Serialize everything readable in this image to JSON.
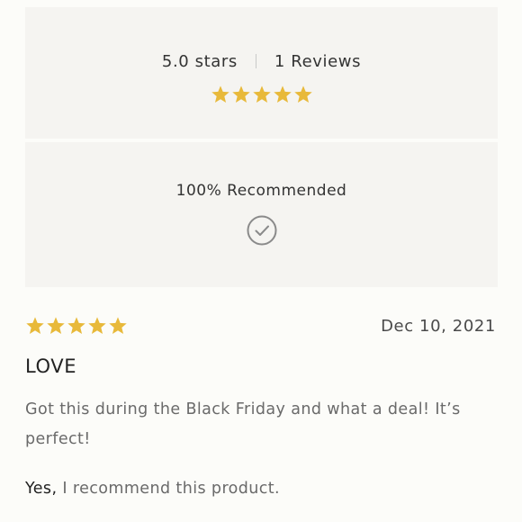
{
  "summary": {
    "average_label": "5.0 stars",
    "reviews_label": "1 Reviews",
    "star_rating": 5,
    "recommend_label": "100% Recommended"
  },
  "review": {
    "rating": 5,
    "date": "Dec 10, 2021",
    "title": "LOVE",
    "body": "Got this during the Black Friday and what a deal! It’s perfect!",
    "recommend_yes": "Yes,",
    "recommend_text": " I recommend this product."
  },
  "colors": {
    "star": "#e8b93a",
    "panel": "#f5f4f1",
    "check": "#8a8a8a"
  },
  "icons": [
    "star-icon",
    "check-circle-icon"
  ]
}
